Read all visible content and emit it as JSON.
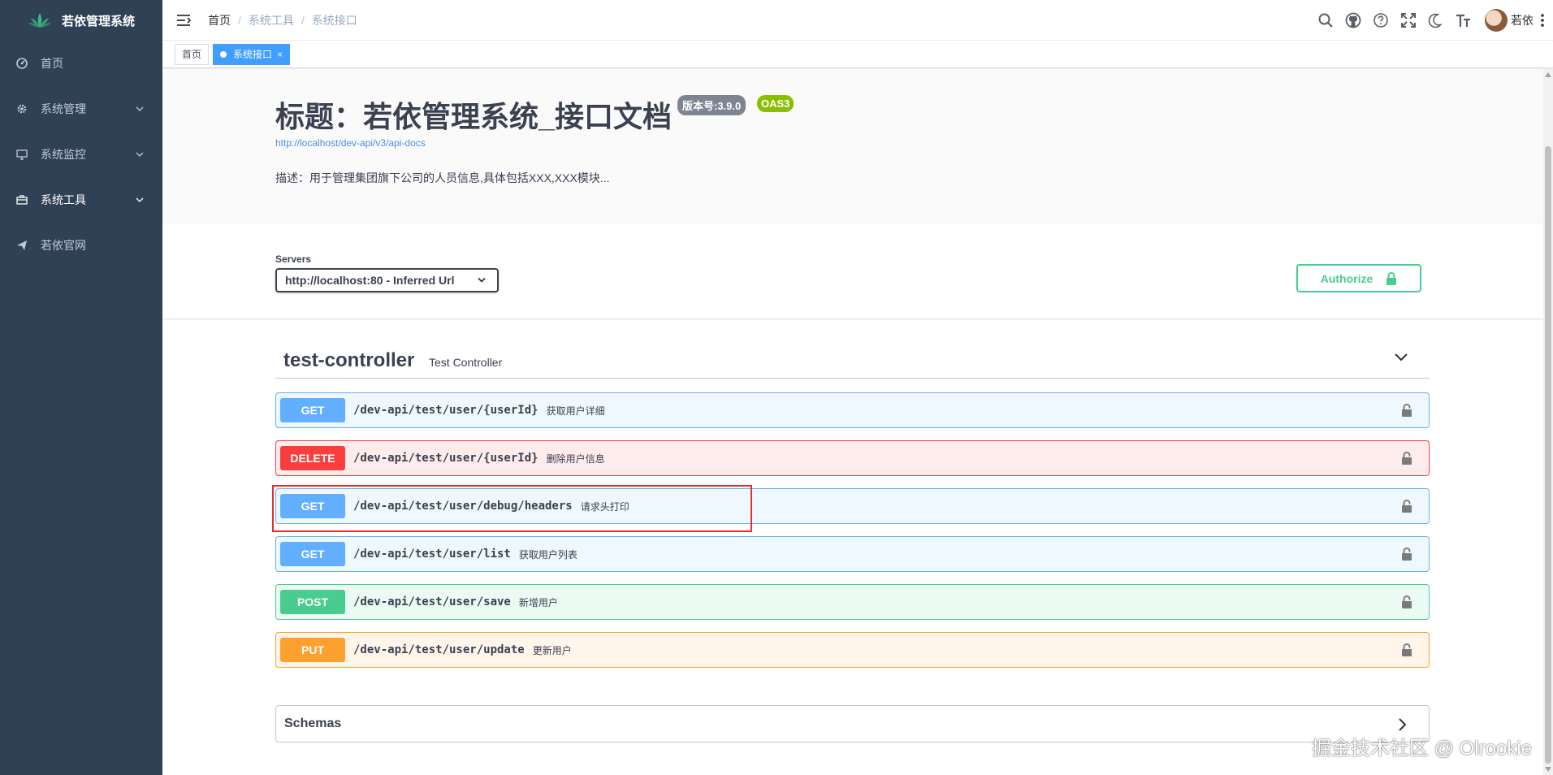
{
  "app": {
    "title": "若依管理系统"
  },
  "sidebar": {
    "items": [
      {
        "label": "首页",
        "icon": "dashboard-icon",
        "expandable": false
      },
      {
        "label": "系统管理",
        "icon": "gear-icon",
        "expandable": true
      },
      {
        "label": "系统监控",
        "icon": "monitor-icon",
        "expandable": true
      },
      {
        "label": "系统工具",
        "icon": "toolbox-icon",
        "expandable": true,
        "active": true
      },
      {
        "label": "若依官网",
        "icon": "send-icon",
        "expandable": false
      }
    ]
  },
  "breadcrumb": [
    "首页",
    "系统工具",
    "系统接口"
  ],
  "breadcrumb_sep": "/",
  "user": {
    "name": "若依"
  },
  "tags": [
    {
      "label": "首页",
      "active": false
    },
    {
      "label": "系统接口",
      "active": true,
      "close": "×"
    }
  ],
  "doc": {
    "title": "标题：若依管理系统_接口文档",
    "version_badge": "版本号:3.9.0",
    "oas_badge": "OAS3",
    "link": "http://localhost/dev-api/v3/api-docs",
    "description": "描述：用于管理集团旗下公司的人员信息,具体包括XXX,XXX模块..."
  },
  "servers": {
    "label": "Servers",
    "selected": "http://localhost:80 - Inferred Url",
    "authorize_label": "Authorize"
  },
  "controller": {
    "name": "test-controller",
    "description": "Test Controller",
    "operations": [
      {
        "method": "GET",
        "path": "/dev-api/test/user/{userId}",
        "summary": "获取用户详细"
      },
      {
        "method": "DELETE",
        "path": "/dev-api/test/user/{userId}",
        "summary": "删除用户信息"
      },
      {
        "method": "GET",
        "path": "/dev-api/test/user/debug/headers",
        "summary": "请求头打印"
      },
      {
        "method": "GET",
        "path": "/dev-api/test/user/list",
        "summary": "获取用户列表"
      },
      {
        "method": "POST",
        "path": "/dev-api/test/user/save",
        "summary": "新增用户"
      },
      {
        "method": "PUT",
        "path": "/dev-api/test/user/update",
        "summary": "更新用户"
      }
    ]
  },
  "schemas": {
    "label": "Schemas"
  },
  "watermark": "掘金技术社区 @ Olrookie",
  "colors": {
    "sidebar_bg": "#304156",
    "get": "#61affe",
    "delete": "#f93e3e",
    "post": "#49cc90",
    "put": "#fca130",
    "tag_active": "#409eff",
    "highlight": "#e0312a"
  }
}
